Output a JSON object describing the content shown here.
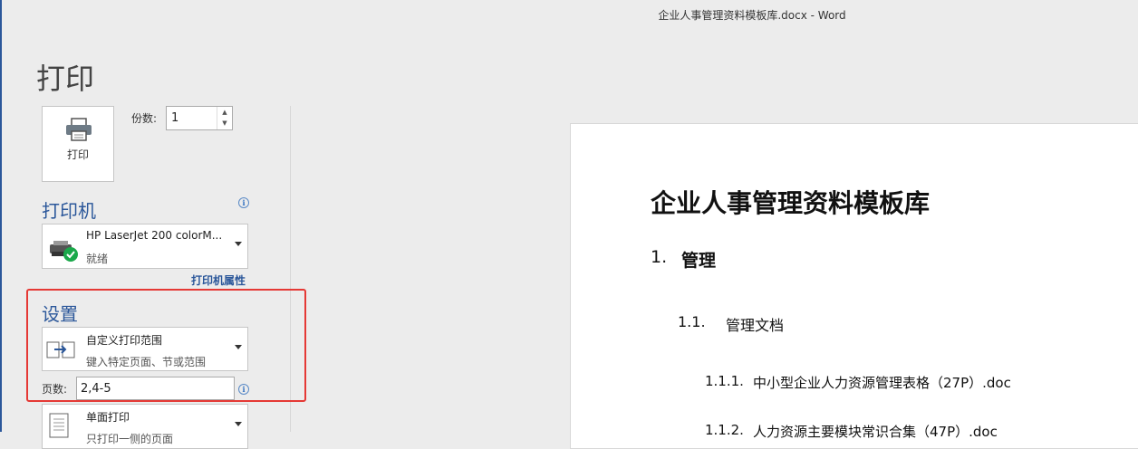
{
  "window": {
    "title": "企业人事管理资料模板库.docx - Word"
  },
  "page": {
    "heading": "打印"
  },
  "print_button": {
    "label": "打印"
  },
  "copies": {
    "label": "份数:",
    "value": "1"
  },
  "printer": {
    "section_title": "打印机",
    "name": "HP LaserJet 200 colorM...",
    "status": "就绪",
    "properties_link": "打印机属性"
  },
  "settings": {
    "section_title": "设置",
    "range": {
      "title": "自定义打印范围",
      "subtitle": "键入特定页面、节或范围"
    },
    "pages": {
      "label": "页数:",
      "value": "2,4-5"
    },
    "sides": {
      "title": "单面打印",
      "subtitle": "只打印一侧的页面"
    }
  },
  "preview": {
    "doc_title": "企业人事管理资料模板库",
    "h1": {
      "number": "1.",
      "text": "管理"
    },
    "h2": {
      "number": "1.1.",
      "text": "管理文档"
    },
    "h3": {
      "number": "1.1.1.",
      "text": "中小型企业人力资源管理表格（27P）.doc"
    },
    "h3b": {
      "number": "1.1.2.",
      "text": "人力资源主要模块常识合集（47P）.doc"
    }
  },
  "colors": {
    "accent": "#2b579a",
    "highlight": "#e53935",
    "printer_ready": "#1aa84a"
  }
}
